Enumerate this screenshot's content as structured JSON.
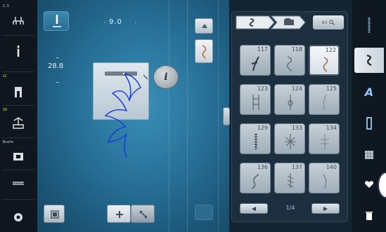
{
  "leftbar": {
    "items": [
      {
        "label": "2.5",
        "icon": "bobbin-thread-icon"
      },
      {
        "label": "",
        "icon": "needle-icon"
      },
      {
        "label": "1C",
        "icon": "presser-foot-icon"
      },
      {
        "label": "5R",
        "icon": "feed-dog-icon"
      },
      {
        "label": "Bsafe",
        "icon": "needle-plate-icon"
      },
      {
        "label": "",
        "icon": "thread-tension-icon"
      },
      {
        "label": "",
        "icon": "settings-gear-icon"
      }
    ]
  },
  "main": {
    "stitch_width": "9.0",
    "stitch_length": "28.8",
    "info_label": "i",
    "bottom_buttons": [
      "plus-button",
      "diagonal-arrows-button"
    ]
  },
  "panel": {
    "tabs": [
      "s-icon",
      "folder-icon"
    ],
    "zoom_label": "64",
    "patterns": [
      {
        "num": "117",
        "selected": false
      },
      {
        "num": "118",
        "selected": false
      },
      {
        "num": "122",
        "selected": true
      },
      {
        "num": "123",
        "selected": false
      },
      {
        "num": "124",
        "selected": false
      },
      {
        "num": "125",
        "selected": false
      },
      {
        "num": "129",
        "selected": false
      },
      {
        "num": "133",
        "selected": false
      },
      {
        "num": "134",
        "selected": false
      },
      {
        "num": "136",
        "selected": false
      },
      {
        "num": "137",
        "selected": false
      },
      {
        "num": "140",
        "selected": false
      }
    ],
    "page_indicator": "1/4"
  },
  "rightbar": {
    "tabs": [
      "stitch-column-icon",
      "decorative-stitch-icon",
      "alphabet-icon",
      "buttonhole-icon",
      "quilt-icon",
      "heart-icon",
      "trash-icon"
    ],
    "active_index": 1,
    "alphabet_label": "A"
  }
}
